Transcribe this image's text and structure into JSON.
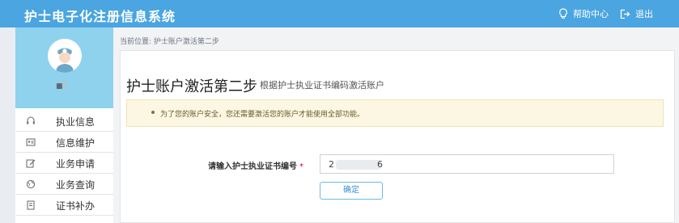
{
  "header": {
    "app_title": "护士电子化注册信息系统",
    "help_label": "帮助中心",
    "logout_label": "退出",
    "icons": [
      "lightbulb-icon",
      "logout-icon"
    ]
  },
  "sidebar": {
    "user": {
      "name": "■"
    },
    "items": [
      {
        "label": "执业信息",
        "icon": "headset-icon"
      },
      {
        "label": "信息维护",
        "icon": "id-card-icon"
      },
      {
        "label": "业务申请",
        "icon": "edit-icon"
      },
      {
        "label": "业务查询",
        "icon": "globe-icon"
      },
      {
        "label": "证书补办",
        "icon": "certificate-icon"
      }
    ]
  },
  "breadcrumb": {
    "prefix": "当前位置:",
    "current": "护士账户激活第二步"
  },
  "panel": {
    "title": "护士账户激活第二步",
    "subtitle": "根据护士执业证书编码激活账户",
    "notice": "为了您的账户安全，您还需要激活您的账户才能使用全部功能。",
    "field_label": "请输入护士执业证书编号",
    "required_mark": "*",
    "field_value_start": "2",
    "field_value_end": "6",
    "confirm_label": "确定"
  },
  "colors": {
    "header_bg": "#4aa5e0",
    "profile_bg": "#8fd2ee",
    "notice_bg": "#fcf7e3",
    "button_border": "#6db8e6"
  }
}
